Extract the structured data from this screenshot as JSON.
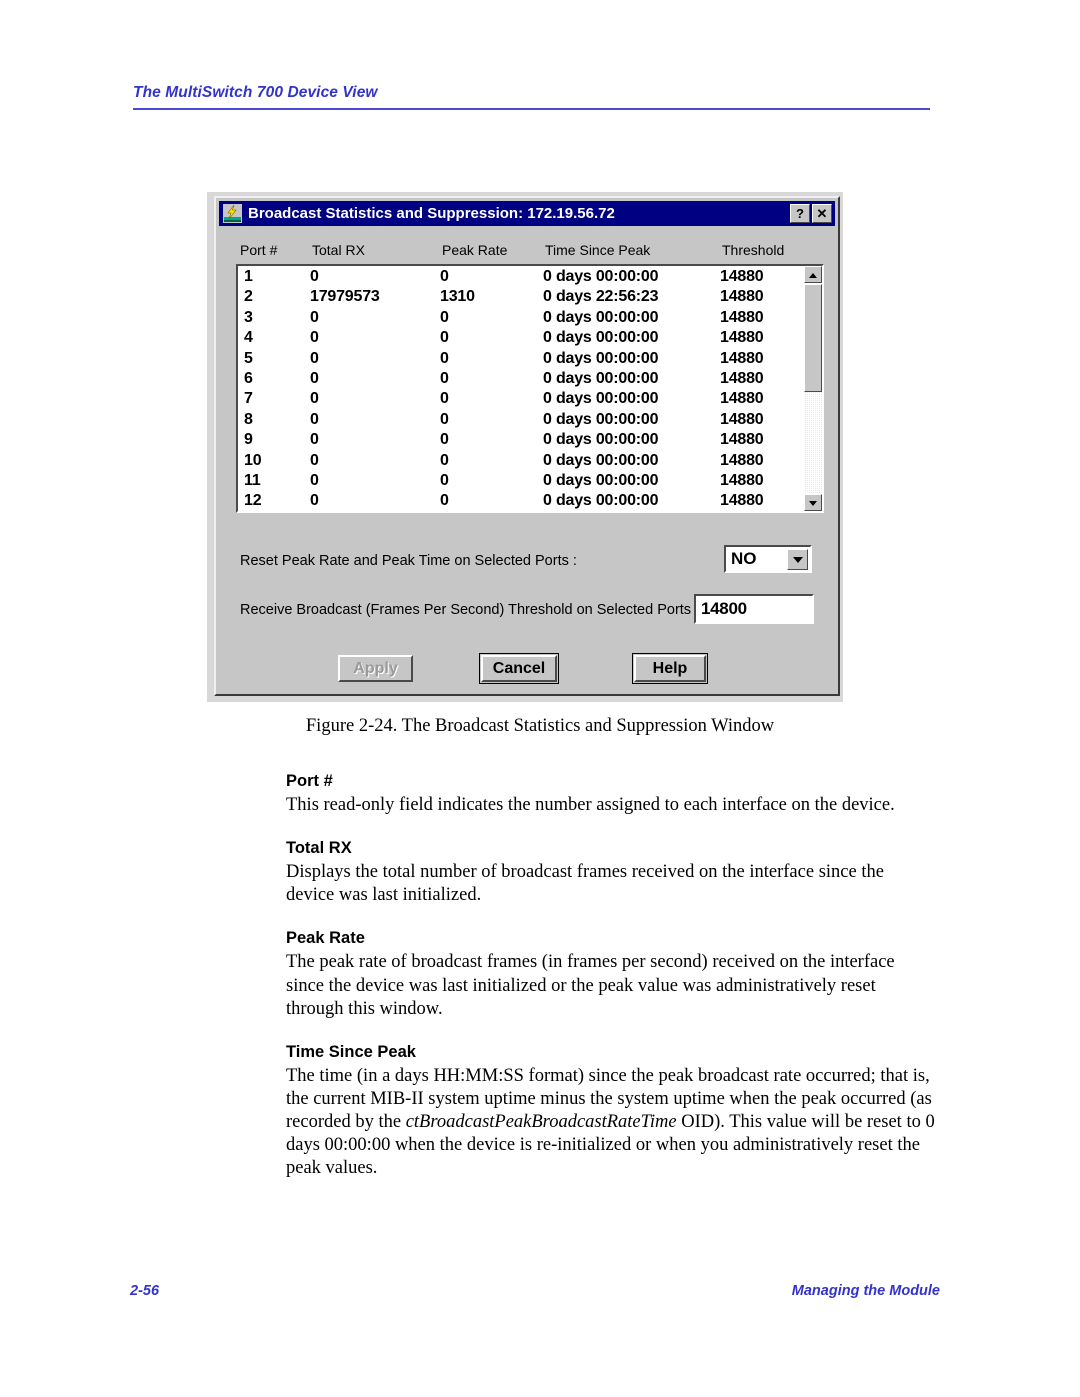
{
  "page": {
    "running_head": "The MultiSwitch 700 Device View",
    "footer_page_number": "2-56",
    "footer_section": "Managing the Module",
    "figure_caption": "Figure 2-24.  The Broadcast Statistics and Suppression Window"
  },
  "dialog": {
    "title": "Broadcast Statistics and Suppression: 172.19.56.72",
    "icon": "lightning-bolt-icon",
    "help_button_label": "?",
    "close_button_label": "✕",
    "table": {
      "columns": [
        "Port #",
        "Total RX",
        "Peak Rate",
        "Time Since Peak",
        "Threshold"
      ],
      "rows": [
        {
          "port": "1",
          "total_rx": "0",
          "peak_rate": "0",
          "time_since_peak": "0 days 00:00:00",
          "threshold": "14880"
        },
        {
          "port": "2",
          "total_rx": "17979573",
          "peak_rate": "1310",
          "time_since_peak": "0 days 22:56:23",
          "threshold": "14880"
        },
        {
          "port": "3",
          "total_rx": "0",
          "peak_rate": "0",
          "time_since_peak": "0 days 00:00:00",
          "threshold": "14880"
        },
        {
          "port": "4",
          "total_rx": "0",
          "peak_rate": "0",
          "time_since_peak": "0 days 00:00:00",
          "threshold": "14880"
        },
        {
          "port": "5",
          "total_rx": "0",
          "peak_rate": "0",
          "time_since_peak": "0 days 00:00:00",
          "threshold": "14880"
        },
        {
          "port": "6",
          "total_rx": "0",
          "peak_rate": "0",
          "time_since_peak": "0 days 00:00:00",
          "threshold": "14880"
        },
        {
          "port": "7",
          "total_rx": "0",
          "peak_rate": "0",
          "time_since_peak": "0 days 00:00:00",
          "threshold": "14880"
        },
        {
          "port": "8",
          "total_rx": "0",
          "peak_rate": "0",
          "time_since_peak": "0 days 00:00:00",
          "threshold": "14880"
        },
        {
          "port": "9",
          "total_rx": "0",
          "peak_rate": "0",
          "time_since_peak": "0 days 00:00:00",
          "threshold": "14880"
        },
        {
          "port": "10",
          "total_rx": "0",
          "peak_rate": "0",
          "time_since_peak": "0 days 00:00:00",
          "threshold": "14880"
        },
        {
          "port": "11",
          "total_rx": "0",
          "peak_rate": "0",
          "time_since_peak": "0 days 00:00:00",
          "threshold": "14880"
        },
        {
          "port": "12",
          "total_rx": "0",
          "peak_rate": "0",
          "time_since_peak": "0 days 00:00:00",
          "threshold": "14880"
        }
      ]
    },
    "controls": {
      "reset_label": "Reset Peak Rate and Peak Time on Selected Ports :",
      "reset_value": "NO",
      "threshold_label": "Receive Broadcast (Frames Per Second) Threshold on Selected Ports :",
      "threshold_value": "14800"
    },
    "buttons": {
      "apply": "Apply",
      "cancel": "Cancel",
      "help": "Help"
    }
  },
  "body": {
    "sections": [
      {
        "term": "Port #",
        "text": "This read-only field indicates the number assigned to each interface on the device."
      },
      {
        "term": "Total RX",
        "text": "Displays the total number of broadcast frames received on the interface since the device was last initialized."
      },
      {
        "term": "Peak Rate",
        "text": "The peak rate of broadcast frames (in frames per second) received on the interface since the device was last initialized or the peak value was administratively reset through this window."
      },
      {
        "term": "Time Since Peak",
        "text_part1": "The time (in a days HH:MM:SS format) since the peak broadcast rate occurred; that is, the current MIB-II system uptime minus the system uptime when the peak occurred (as recorded by the ",
        "text_italic": "ctBroadcastPeakBroadcastRateTime",
        "text_part2": " OID). This value will be reset to 0 days 00:00:00 when the device is re-initialized or when you administratively reset the peak values."
      }
    ]
  },
  "colors": {
    "accent_blue": "#3333cc",
    "titlebar_blue": "#000083",
    "dialog_face": "#c6c6c6"
  }
}
